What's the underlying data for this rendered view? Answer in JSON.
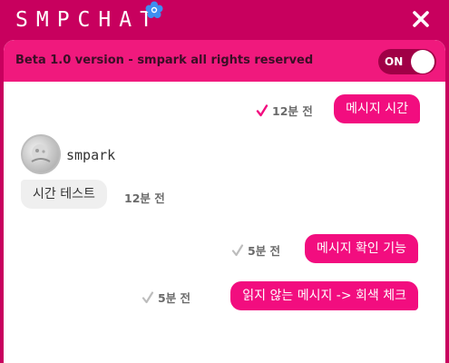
{
  "app": {
    "brand": "SMPCHAT",
    "colors": {
      "accent": "#c8005e",
      "bubble": "#f20d7f",
      "banner": "#f0197d",
      "read_check": "#f20d7f",
      "unread_check": "#bdbdbd"
    },
    "icons": {
      "logo": "flower-icon",
      "close": "close-icon",
      "check": "check-icon"
    }
  },
  "banner": {
    "text": "Beta 1.0 version - smpark all rights reserved",
    "toggle_label": "ON"
  },
  "messages": [
    {
      "direction": "sent",
      "text": "메시지 시간",
      "time": "12분 전",
      "read": true
    },
    {
      "direction": "received",
      "sender": "smpark",
      "text": "시간 테스트",
      "time": "12분 전"
    },
    {
      "direction": "sent",
      "text": "메시지 확인 기능",
      "time": "5분 전",
      "read": false
    },
    {
      "direction": "sent",
      "text": "읽지 않는 메시지 -> 회색 체크",
      "time": "5분 전",
      "read": false
    }
  ]
}
